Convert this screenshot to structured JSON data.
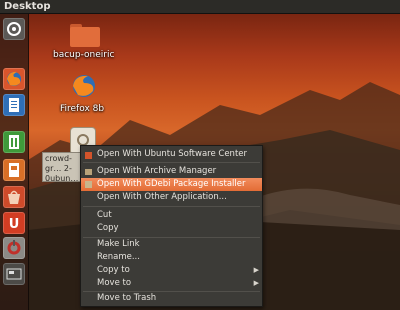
{
  "top_panel": {
    "title": "Desktop"
  },
  "launcher": {
    "items": [
      {
        "icon": "dash-home-icon"
      },
      {
        "icon": "firefox-icon"
      },
      {
        "icon": "libreoffice-writer-icon"
      },
      {
        "icon": "libreoffice-calc-icon"
      },
      {
        "icon": "libreoffice-impress-icon"
      },
      {
        "icon": "ubuntu-software-center-icon"
      },
      {
        "icon": "ubuntu-one-icon"
      },
      {
        "icon": "system-settings-icon"
      },
      {
        "icon": "workspace-switcher-icon"
      }
    ]
  },
  "desktop": {
    "icons": [
      {
        "label": "bacup-oneiric",
        "icon": "folder-icon"
      },
      {
        "label": "Firefox 8b",
        "icon": "firefox-icon"
      }
    ],
    "selected_file": {
      "label": "crowd-gr… 2-0ubun… d…",
      "icon": "deb-package-icon"
    }
  },
  "context_menu": {
    "items": [
      {
        "label": "Open With Ubuntu Software Center",
        "icon": "software-center-icon"
      },
      {
        "label": "Open With Archive Manager",
        "icon": "archive-manager-icon"
      },
      {
        "label": "Open With GDebi Package Installer",
        "icon": "gdebi-icon",
        "highlighted": true
      },
      {
        "label": "Open With Other Application..."
      },
      {
        "label": "Cut"
      },
      {
        "label": "Copy"
      },
      {
        "label": "Make Link"
      },
      {
        "label": "Rename..."
      },
      {
        "label": "Copy to",
        "submenu": true
      },
      {
        "label": "Move to",
        "submenu": true
      },
      {
        "label": "Move to Trash"
      }
    ]
  },
  "colors": {
    "accent": "#e36c35",
    "menu_bg": "#3c3b37",
    "panel_bg": "#2c2b27"
  }
}
